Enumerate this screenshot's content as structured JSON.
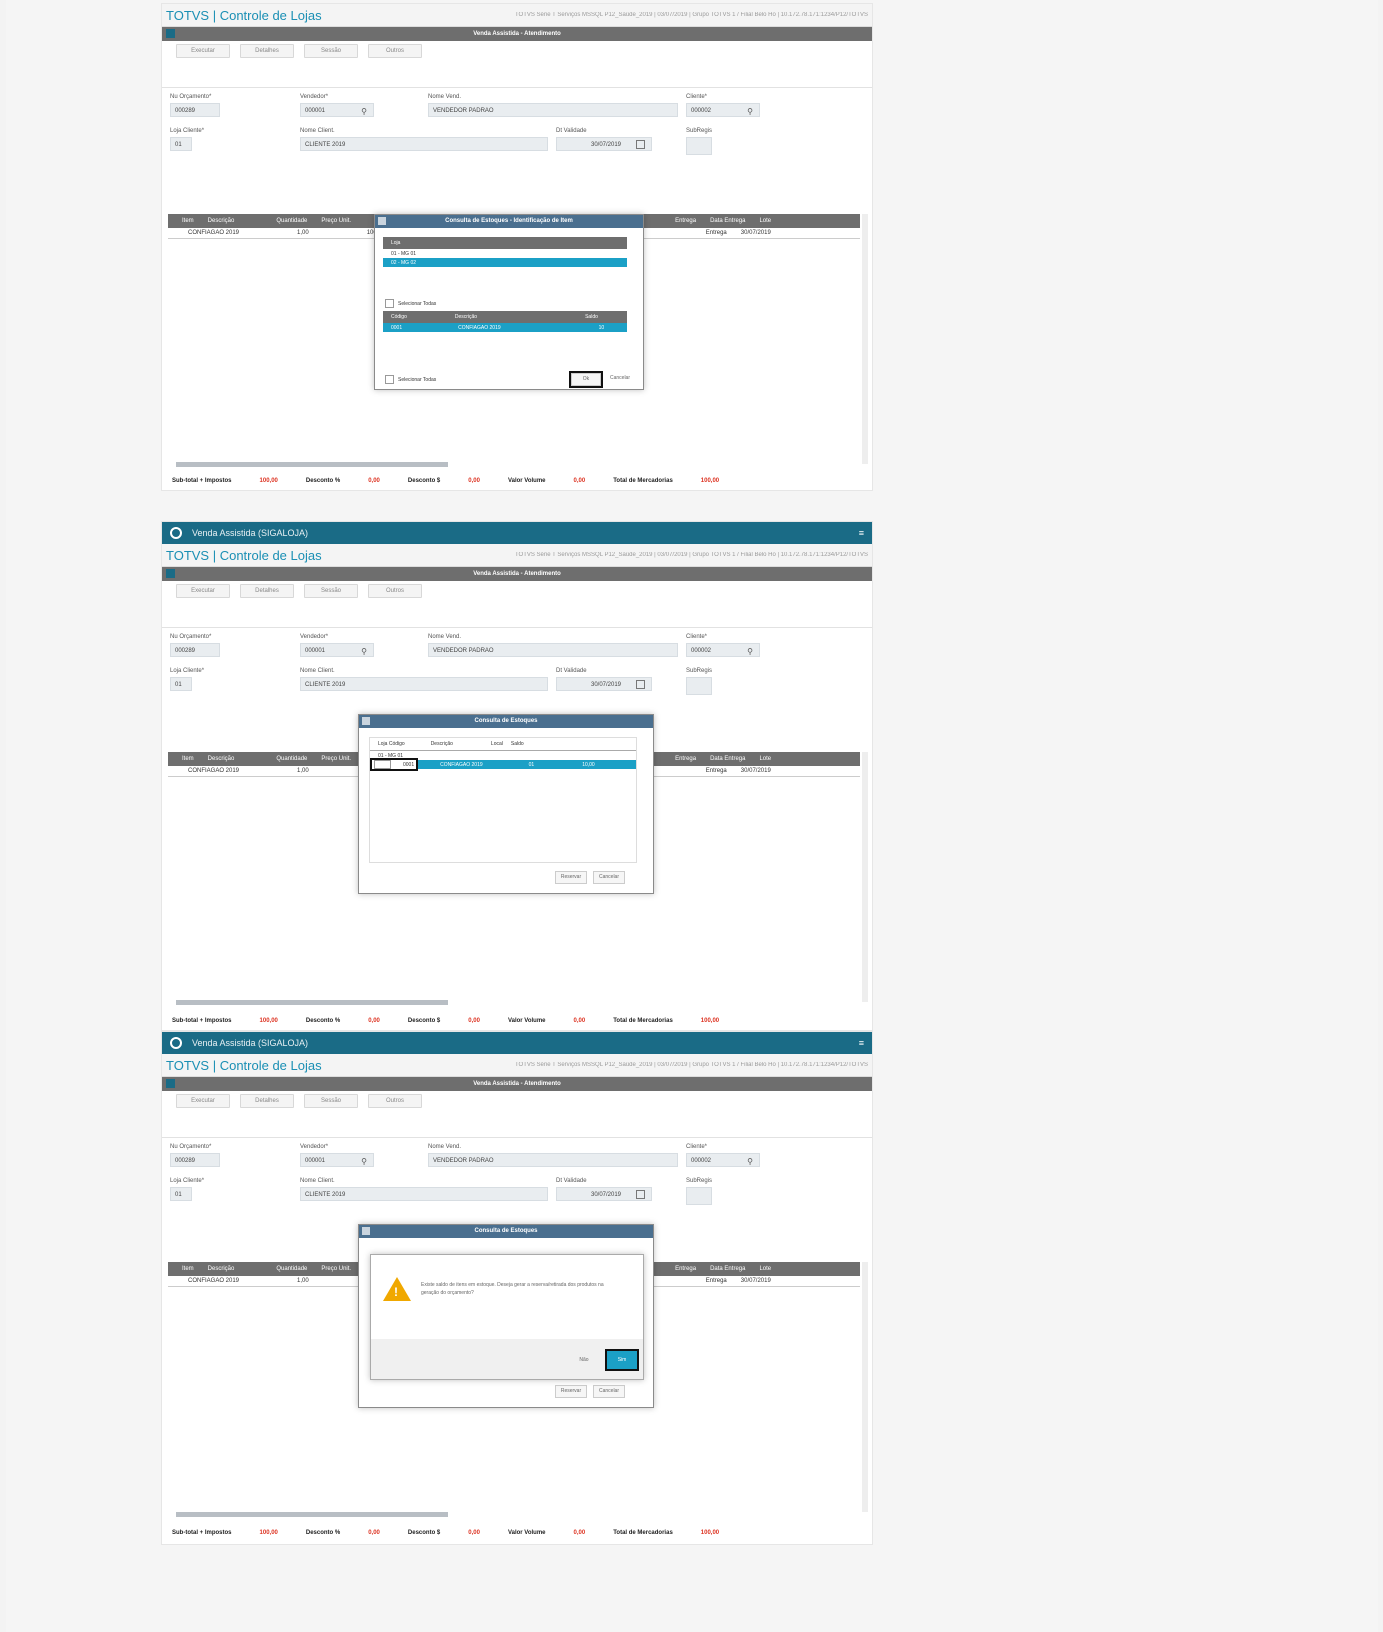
{
  "app_title": "TOTVS | Controle de Lojas",
  "env_info": "TOTVS Série T Serviços MSSQL P12_Saúde_2019 | 03/07/2019 | Grupo TOTVS 1 / Filial Belo Ho | 10.172.78.171:1234/P12/TOTVS",
  "tab_title": "Venda Assistida (SIGALOJA)",
  "window_title": "Venda Assistida - Atendimento",
  "toolbar": {
    "b1": "Executar",
    "b2": "Detalhes",
    "b3": "Sessão",
    "b4": "Outros"
  },
  "form": {
    "num_orc_label": "Nu Orçamento*",
    "num_orc_value": "000289",
    "vendedor_label": "Vendedor*",
    "vendedor_value": "000001",
    "nome_vend_label": "Nome Vend.",
    "nome_vend_value": "VENDEDOR PADRAO",
    "cliente_label": "Cliente*",
    "cliente_value": "000002",
    "loja_label": "Loja Cliente*",
    "loja_value": "01",
    "nome_cli_label": "Nome Client.",
    "nome_cli_value": "CLIENTE 2019",
    "dt_label": "Dt Validade",
    "dt_value": "30/07/2019",
    "subgrupo_label": "SubRegis"
  },
  "grid": {
    "headers": [
      "Item",
      "Descrição",
      "Quantidade",
      "Preço Unit.",
      "Entrega",
      "Data Entrega",
      "Lote"
    ],
    "row": {
      "desc": "CONFIAGAO 2019",
      "qtd": "1,00",
      "preco": "100,0000",
      "entrega": "Entrega",
      "data": "30/07/2019"
    }
  },
  "footer": {
    "subtotal_label": "Sub-total + Impostos",
    "subtotal_value": "100,00",
    "desc_pct_label": "Desconto %",
    "desc_pct_value": "0,00",
    "desc_val_label": "Desconto $",
    "desc_val_value": "0,00",
    "valor_label": "Valor Volume",
    "valor_value": "0,00",
    "total_label": "Total de Mercadorias",
    "total_value": "100,00"
  },
  "dialog1": {
    "title": "Consulta de Estoques - Identificação de Item",
    "loja_header": "Loja",
    "loja_rows": [
      "01 - MG 01",
      "02 - MG 02"
    ],
    "select_all": "Selecionar Todas",
    "headers": [
      "Código",
      "Descrição",
      "Saldo"
    ],
    "row": [
      "0001",
      "CONFIAGAO 2019",
      "10"
    ],
    "ok": "Ok",
    "cancel": "Cancelar"
  },
  "dialog2": {
    "title": "Consulta de Estoques",
    "headers": [
      "Loja Código",
      "Descrição",
      "Local",
      "Saldo"
    ],
    "row1": "01 - MG 01",
    "row2": [
      "0001",
      "CONFIAGAO 2019",
      "01",
      "10,00"
    ],
    "confirm": "Reservar",
    "cancel": "Cancelar"
  },
  "dialog3": {
    "title": "Consulta de Estoques",
    "message": "Existe saldo de itens em estoque. Deseja gerar a reserva/retirada dos produtos na geração do orçamento?",
    "no": "Não",
    "yes": "Sim",
    "confirm": "Reservar",
    "cancel": "Cancelar"
  }
}
